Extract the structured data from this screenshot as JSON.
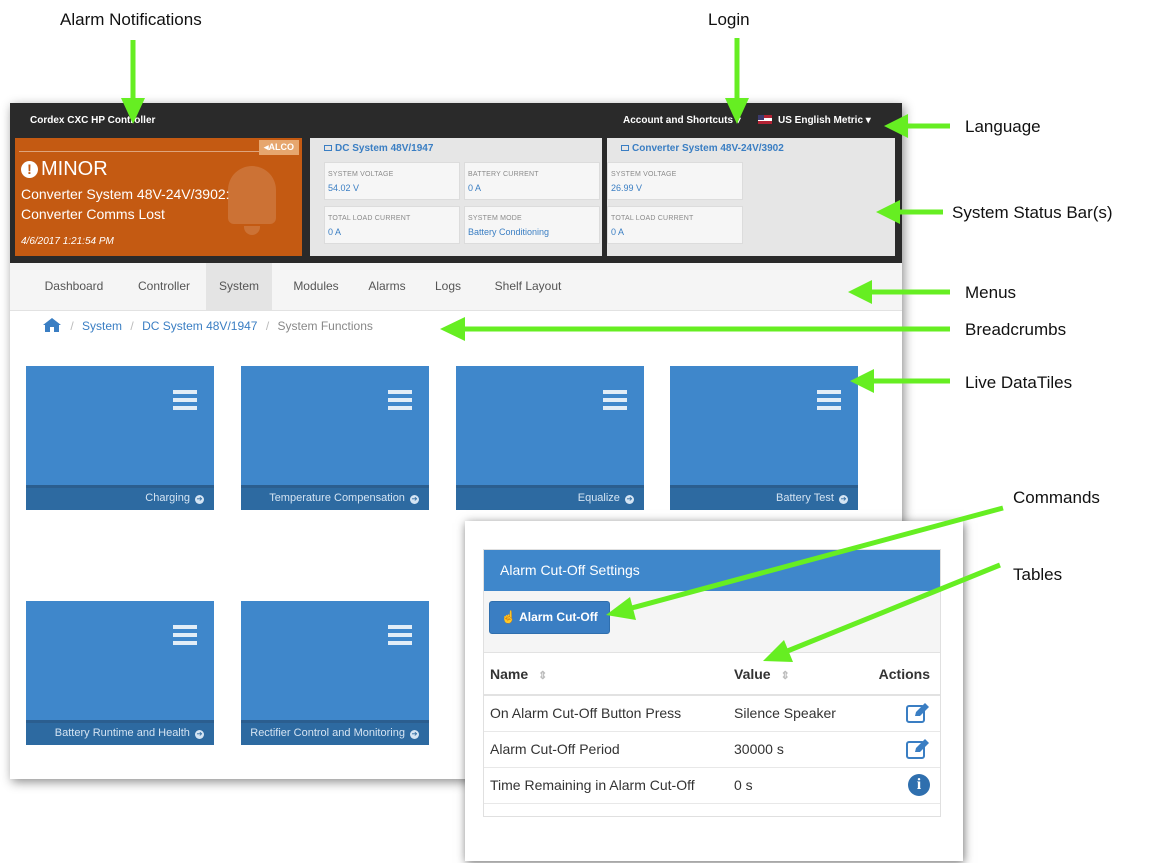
{
  "callouts": {
    "alarm_notifications": "Alarm Notifications",
    "login": "Login",
    "language": "Language",
    "system_status_bars": "System Status Bar(s)",
    "menus": "Menus",
    "breadcrumbs": "Breadcrumbs",
    "live_datatiles": "Live DataTiles",
    "commands": "Commands",
    "tables": "Tables"
  },
  "header": {
    "app_title": "Cordex CXC HP Controller",
    "account_label": "Account and Shortcuts",
    "language_label": "US English Metric",
    "caret": "▾"
  },
  "alarm": {
    "alco_badge": "ALCO",
    "severity": "MINOR",
    "message_line1": "Converter System 48V-24V/3902:",
    "message_line2": "Converter Comms Lost",
    "timestamp": "4/6/2017 1:21:54 PM"
  },
  "dc_system": {
    "title": "DC System 48V/1947",
    "system_voltage_label": "SYSTEM VOLTAGE",
    "system_voltage_value": "54.02 V",
    "battery_current_label": "BATTERY CURRENT",
    "battery_current_value": "0 A",
    "total_load_current_label": "TOTAL LOAD CURRENT",
    "total_load_current_value": "0 A",
    "system_mode_label": "SYSTEM MODE",
    "system_mode_value": "Battery Conditioning"
  },
  "converter_system": {
    "title": "Converter System 48V-24V/3902",
    "system_voltage_label": "SYSTEM VOLTAGE",
    "system_voltage_value": "26.99 V",
    "total_load_current_label": "TOTAL LOAD CURRENT",
    "total_load_current_value": "0 A"
  },
  "menu": {
    "items": [
      "Dashboard",
      "Controller",
      "System",
      "Modules",
      "Alarms",
      "Logs",
      "Shelf Layout"
    ],
    "active": "System"
  },
  "breadcrumb": {
    "separator": "/",
    "items": [
      "System",
      "DC System 48V/1947",
      "System Functions"
    ]
  },
  "tiles": {
    "items": [
      "Charging",
      "Temperature Compensation",
      "Equalize",
      "Battery Test",
      "Battery Runtime and Health",
      "Rectifier Control and Monitoring"
    ]
  },
  "popup": {
    "panel_title": "Alarm Cut-Off Settings",
    "command_button": "Alarm Cut-Off",
    "columns": {
      "name": "Name",
      "value": "Value",
      "actions": "Actions"
    },
    "sort_glyph": "⇕",
    "rows": [
      {
        "name": "On Alarm Cut-Off Button Press",
        "value": "Silence Speaker",
        "action": "edit-icon"
      },
      {
        "name": "Alarm Cut-Off Period",
        "value": "30000 s",
        "action": "edit-icon"
      },
      {
        "name": "Time Remaining in Alarm Cut-Off",
        "value": "0 s",
        "action": "info-icon"
      }
    ]
  },
  "colors": {
    "arrow_green": "#66ee22",
    "alarm_orange": "#c45a12",
    "tile_blue": "#3f87cb",
    "topbar_dark": "#2a2a2a"
  }
}
